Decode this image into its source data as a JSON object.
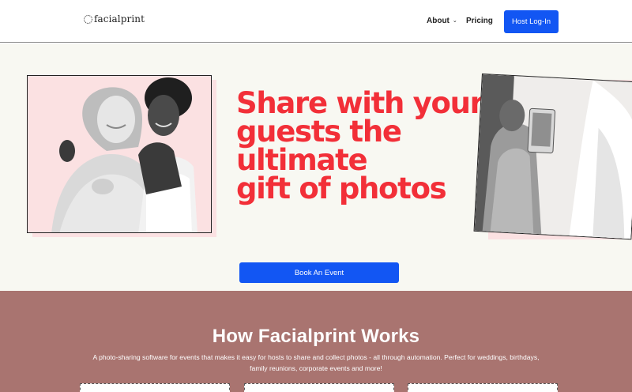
{
  "header": {
    "logo_text": "facialprint",
    "nav": {
      "about": "About",
      "pricing": "Pricing"
    },
    "host_login": "Host Log-In"
  },
  "hero": {
    "headline_lines": [
      "Share with your",
      "guests the",
      "ultimate",
      "gift of photos"
    ],
    "book_button": "Book An Event",
    "colors": {
      "headline": "#f22f38",
      "accent_pink": "#fbe1e2",
      "button": "#1256f3"
    }
  },
  "how": {
    "title": "How Facialprint Works",
    "subtitle_line1": "A photo-sharing software for events that makes it easy for hosts to share and collect photos - all through automation. Perfect for weddings, birthdays,",
    "subtitle_line2": "family reunions, corporate events and more!",
    "background": "#a97470"
  }
}
